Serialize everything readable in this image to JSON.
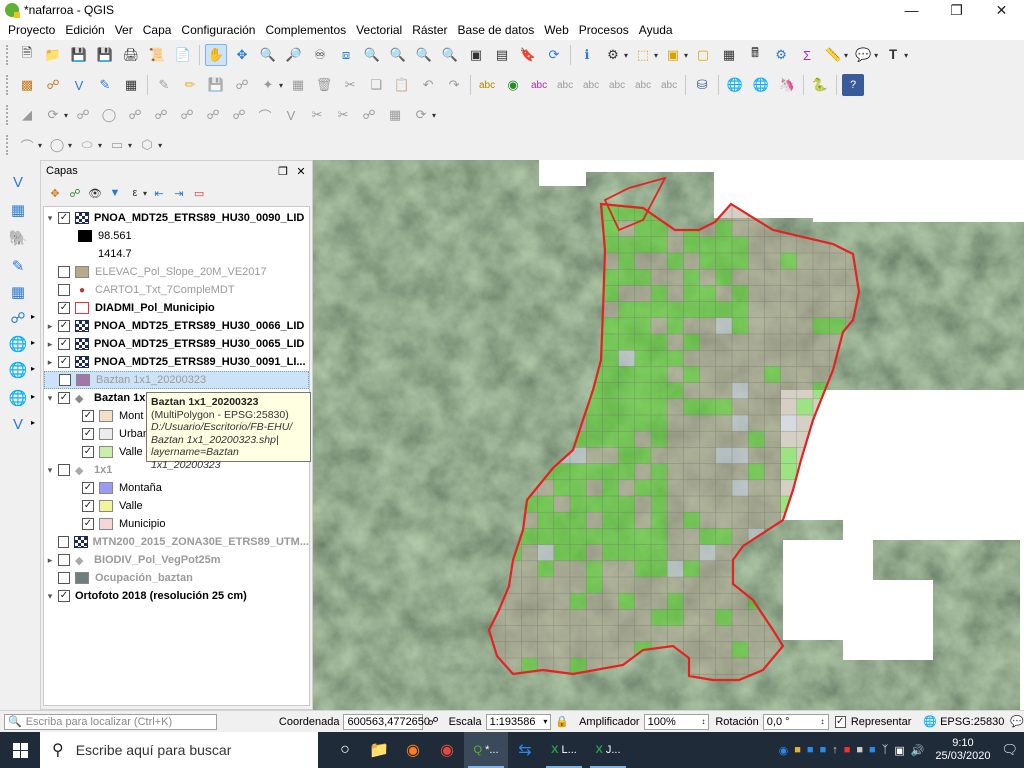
{
  "window": {
    "title": "*nafarroa - QGIS"
  },
  "menu": [
    "Proyecto",
    "Edición",
    "Ver",
    "Capa",
    "Configuración",
    "Complementos",
    "Vectorial",
    "Ráster",
    "Base de datos",
    "Web",
    "Procesos",
    "Ayuda"
  ],
  "layers_panel": {
    "title": "Capas",
    "layers": [
      {
        "name": "PNOA_MDT25_ETRS89_HU30_0090_LID",
        "checked": true,
        "bold": true,
        "type": "raster"
      },
      {
        "name": "98.561",
        "type": "legend-black"
      },
      {
        "name": "1414.7",
        "type": "legend-white"
      },
      {
        "name": "ELEVAC_Pol_Slope_20M_VE2017",
        "checked": false,
        "grey": true,
        "type": "swatch",
        "color": "#b9a98a"
      },
      {
        "name": "CARTO1_Txt_7CompleMDT",
        "checked": false,
        "grey": true,
        "type": "dot"
      },
      {
        "name": "DIADMI_Pol_Municipio",
        "checked": true,
        "bold": true,
        "type": "swatch",
        "color": "#ffffff",
        "border": "#e33"
      },
      {
        "name": "PNOA_MDT25_ETRS89_HU30_0066_LID",
        "checked": true,
        "bold": true,
        "type": "raster"
      },
      {
        "name": "PNOA_MDT25_ETRS89_HU30_0065_LID",
        "checked": true,
        "bold": true,
        "type": "raster"
      },
      {
        "name": "PNOA_MDT25_ETRS89_HU30_0091_LI...",
        "checked": true,
        "bold": true,
        "type": "raster"
      },
      {
        "name": "Baztan 1x1_20200323",
        "checked": false,
        "grey": true,
        "type": "swatch",
        "color": "#a276a8",
        "selected": true
      },
      {
        "name": "Baztan 1x1",
        "checked": true,
        "bold": true,
        "type": "group"
      },
      {
        "name": "Mont",
        "checked": true,
        "type": "swatch",
        "color": "#f4dfc8"
      },
      {
        "name": "Urban",
        "checked": true,
        "type": "swatch",
        "color": "#ececec"
      },
      {
        "name": "Valle",
        "checked": true,
        "type": "swatch",
        "color": "#c8f0a8"
      },
      {
        "name": "1x1",
        "checked": false,
        "grey": true,
        "type": "group"
      },
      {
        "name": "Montaña",
        "checked": true,
        "type": "swatch",
        "color": "#9b9bf4"
      },
      {
        "name": "Valle",
        "checked": true,
        "type": "swatch",
        "color": "#f3f39a"
      },
      {
        "name": "Municipio",
        "checked": true,
        "type": "swatch",
        "color": "#f4d8d8"
      },
      {
        "name": "MTN200_2015_ZONA30E_ETRS89_UTM...",
        "checked": false,
        "grey": true,
        "type": "raster"
      },
      {
        "name": "BIODIV_Pol_VegPot25m",
        "checked": false,
        "grey": true,
        "type": "group"
      },
      {
        "name": "Ocupación_baztan",
        "checked": false,
        "grey": true,
        "type": "swatch",
        "color": "#6f7f7f"
      },
      {
        "name": "Ortofoto 2018 (resolución 25 cm)",
        "checked": true,
        "bold": true,
        "type": "group"
      }
    ]
  },
  "tooltip": {
    "title": "Baztan 1x1_20200323",
    "crs": "(MultiPolygon - EPSG:25830)",
    "path1": "D:/Usuario/Escritorio/FB-EHU/",
    "path2": "Baztan 1x1_20200323.shp|",
    "path3": "layername=Baztan 1x1_20200323"
  },
  "statusbar": {
    "locator_placeholder": "Escriba para localizar (Ctrl+K)",
    "coord_label": "Coordenada",
    "coord_value": "600563,4772650",
    "scale_label": "Escala",
    "scale_value": "1:193586",
    "magnifier_label": "Amplificador",
    "magnifier_value": "100%",
    "rotation_label": "Rotación",
    "rotation_value": "0,0 °",
    "render_label": "Representar",
    "crs": "EPSG:25830"
  },
  "taskbar": {
    "search_placeholder": "Escribe aquí para buscar",
    "apps": [
      "Q *...",
      "X L...",
      "X J..."
    ],
    "time": "9:10",
    "date": "25/03/2020"
  },
  "colors": {
    "boundary": "#e32222",
    "valley_cell": "#5fd234",
    "mountain_cell": "#b5a893",
    "urban_cell": "#c4cad6"
  }
}
